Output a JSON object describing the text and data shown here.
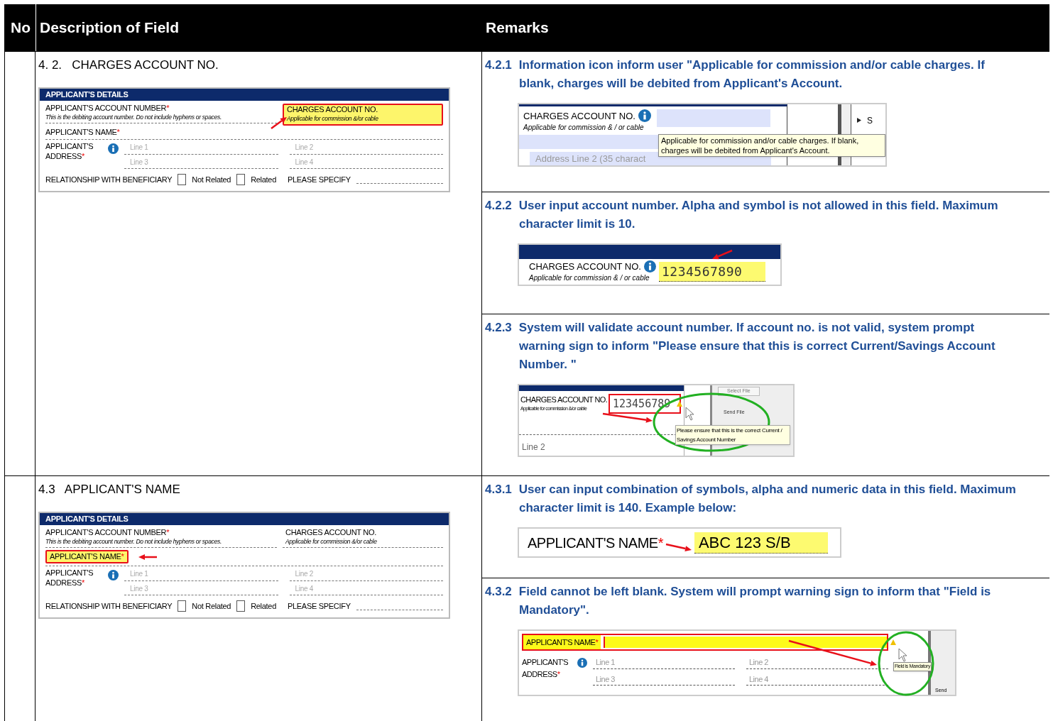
{
  "header": {
    "no": "No",
    "description": "Description of Field",
    "remarks": "Remarks"
  },
  "sections": [
    {
      "title": "4. 2.   CHARGES ACCOUNT NO.",
      "form": {
        "charges_highlighted": true,
        "name_highlighted": false,
        "title": "APPLICANT'S DETAILS",
        "account_label": "APPLICANT'S ACCOUNT NUMBER",
        "account_hint": "This is the debiting account number. Do not include hyphens or spaces.",
        "required_mark": "*",
        "charges_label": "CHARGES ACCOUNT NO.",
        "charges_hint": "Applicable for commission &/or cable",
        "name_label": "APPLICANT'S NAME",
        "address_label_1": "APPLICANT'S",
        "address_label_2": "ADDRESS",
        "address_placeholders": [
          "Line 1",
          "Line 2",
          "Line 3",
          "Line 4"
        ],
        "relationship_label": "RELATIONSHIP WITH BENEFICIARY",
        "options": [
          {
            "label": "Not Related",
            "checked": false
          },
          {
            "label": "Related",
            "checked": false
          }
        ],
        "specify_label": "PLEASE SPECIFY"
      },
      "remarks": [
        {
          "number": "4.2.1",
          "text": "Information icon  inform user \"Applicable for commission and/or cable charges. If blank, charges will be debited from Applicant's Account.",
          "example": {
            "kind": "tooltip",
            "label": "CHARGES ACCOUNT NO.",
            "hint": "Applicable for commission & / or cable",
            "placeholder": "Address Line 2 (35 charact",
            "tooltip": "Applicable for commission and/or cable charges. If blank, charges will be debited from Applicant's Account.",
            "side_text": "S"
          }
        },
        {
          "number": "4.2.2",
          "text": "User input account number. Alpha and symbol is not allowed in this field. Maximum character limit is 10.",
          "example": {
            "kind": "input",
            "label": "CHARGES ACCOUNT NO.",
            "hint": "Applicable for commission & / or cable",
            "value": "1234567890"
          }
        },
        {
          "number": "4.2.3",
          "text": "System will validate account number. If account no. is not valid, system prompt warning sign to inform \"Please ensure that this is correct Current/Savings Account Number. \"",
          "example": {
            "kind": "validation",
            "label": "CHARGES ACCOUNT NO.",
            "hint": "Applicable for commission &/or cable",
            "value": "123456789",
            "line": "Line 2",
            "tooltip": "Please ensure that this is the correct Current / Savings Account Number",
            "side_texts": [
              "Select File",
              "Send File"
            ]
          }
        }
      ]
    },
    {
      "title": "4.3   APPLICANT'S NAME",
      "form": {
        "charges_highlighted": false,
        "name_highlighted": true,
        "title": "APPLICANT'S DETAILS",
        "account_label": "APPLICANT'S ACCOUNT NUMBER",
        "account_hint": "This is the debiting account number. Do not include hyphens or spaces.",
        "required_mark": "*",
        "charges_label": "CHARGES ACCOUNT NO.",
        "charges_hint": "Applicable for commission &/or cable",
        "name_label": "APPLICANT'S NAME",
        "address_label_1": "APPLICANT'S",
        "address_label_2": "ADDRESS",
        "address_placeholders": [
          "Line 1",
          "Line 2",
          "Line 3",
          "Line 4"
        ],
        "relationship_label": "RELATIONSHIP WITH BENEFICIARY",
        "options": [
          {
            "label": "Not Related",
            "checked": false
          },
          {
            "label": "Related",
            "checked": false
          }
        ],
        "specify_label": "PLEASE SPECIFY"
      },
      "remarks": [
        {
          "number": "4.3.1",
          "text": "User can input combination of symbols, alpha and numeric data in this field.  Maximum character limit is 140.      Example below:",
          "example": {
            "kind": "example",
            "label": "APPLICANT'S NAME",
            "mark": "*",
            "value": "ABC 123 S/B"
          }
        },
        {
          "number": "4.3.2",
          "text": "Field cannot be left blank. System will prompt warning sign to inform that  \"Field is Mandatory\".",
          "example": {
            "kind": "mandatory",
            "label": "APPLICANT'S NAME",
            "mark": "*",
            "address_label_1": "APPLICANT'S",
            "address_label_2": "ADDRESS",
            "address_placeholders": [
              "Line 1",
              "Line 2",
              "Line 3",
              "Line 4"
            ],
            "tooltip": "Field is Mandatory",
            "side_text": "Send"
          }
        }
      ]
    }
  ]
}
